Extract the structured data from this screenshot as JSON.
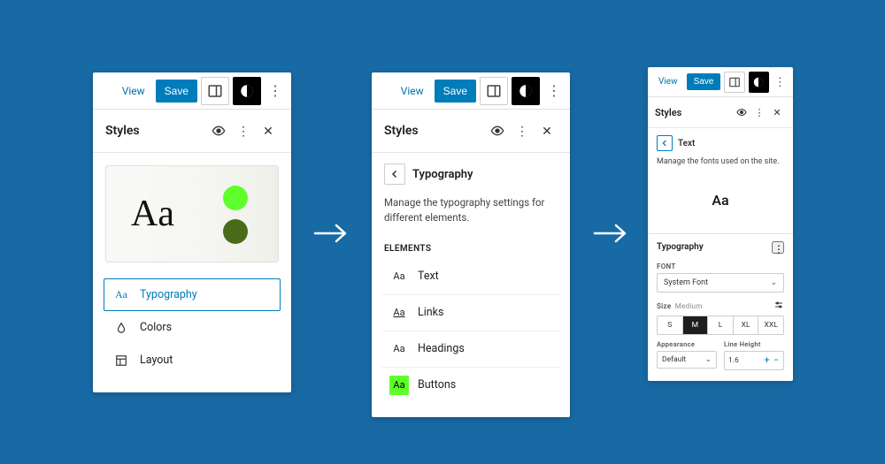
{
  "toolbar": {
    "view": "View",
    "save": "Save"
  },
  "styles_title": "Styles",
  "panel1": {
    "preview_aa": "Aa",
    "colors": {
      "dot1": "#5eff2a",
      "dot2": "#4a6b1a"
    },
    "nav": [
      {
        "icon": "Aa",
        "label": "Typography",
        "active": true
      },
      {
        "icon": "drop",
        "label": "Colors",
        "active": false
      },
      {
        "icon": "layout",
        "label": "Layout",
        "active": false
      }
    ]
  },
  "panel2": {
    "crumb": "Typography",
    "description": "Manage the typography settings for different elements.",
    "section": "Elements",
    "elements": [
      {
        "icon": "Aa",
        "label": "Text",
        "swatch": "plain"
      },
      {
        "icon": "Aa",
        "label": "Links",
        "swatch": "underline"
      },
      {
        "icon": "Aa",
        "label": "Headings",
        "swatch": "plain"
      },
      {
        "icon": "Aa",
        "label": "Buttons",
        "swatch": "green"
      }
    ]
  },
  "panel3": {
    "crumb": "Text",
    "description": "Manage the fonts used on the site.",
    "preview_aa": "Aa",
    "typography_heading": "Typography",
    "font_label": "Font",
    "font_value": "System Font",
    "size_label": "Size",
    "size_current_name": "Medium",
    "size_options": [
      "S",
      "M",
      "L",
      "XL",
      "XXL"
    ],
    "size_selected": "M",
    "appearance_label": "Appearance",
    "appearance_value": "Default",
    "line_height_label": "Line Height",
    "line_height_value": "1.6"
  }
}
